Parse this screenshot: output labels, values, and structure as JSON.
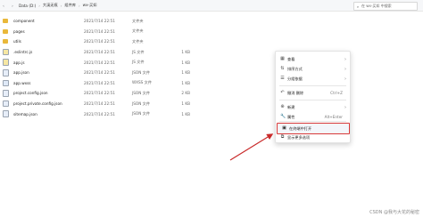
{
  "header": {
    "breadcrumb": [
      "Data (D:)",
      "大溪无痕",
      "组件库",
      "wx-买如"
    ],
    "search_placeholder": "在 wx-买如 中搜索"
  },
  "files": [
    {
      "name": "component",
      "date": "2021/7/14 22:51",
      "type": "文件夹",
      "size": "",
      "icon": "folder"
    },
    {
      "name": "pages",
      "date": "2021/7/14 22:51",
      "type": "文件夹",
      "size": "",
      "icon": "folder"
    },
    {
      "name": "utils",
      "date": "2021/7/14 22:51",
      "type": "文件夹",
      "size": "",
      "icon": "folder"
    },
    {
      "name": ".eslintrc.js",
      "date": "2021/7/14 22:51",
      "type": "JS 文件",
      "size": "1 KB",
      "icon": "js"
    },
    {
      "name": "app.js",
      "date": "2021/7/14 22:51",
      "type": "JS 文件",
      "size": "1 KB",
      "icon": "js"
    },
    {
      "name": "app.json",
      "date": "2021/7/14 22:51",
      "type": "JSON 文件",
      "size": "1 KB",
      "icon": "json"
    },
    {
      "name": "app.wxss",
      "date": "2021/7/14 22:51",
      "type": "WXSS 文件",
      "size": "1 KB",
      "icon": "wxss"
    },
    {
      "name": "project.config.json",
      "date": "2021/7/14 22:51",
      "type": "JSON 文件",
      "size": "2 KB",
      "icon": "json"
    },
    {
      "name": "project.private.config.json",
      "date": "2021/7/14 22:51",
      "type": "JSON 文件",
      "size": "1 KB",
      "icon": "json"
    },
    {
      "name": "sitemap.json",
      "date": "2021/7/14 22:51",
      "type": "JSON 文件",
      "size": "1 KB",
      "icon": "json"
    }
  ],
  "context_menu": [
    {
      "label": "查看",
      "shortcut": "",
      "submenu": true,
      "icon": "view-icon"
    },
    {
      "label": "排序方式",
      "shortcut": "",
      "submenu": true,
      "icon": "sort-icon"
    },
    {
      "label": "分组依据",
      "shortcut": "",
      "submenu": true,
      "icon": "group-icon"
    },
    {
      "label": "撤消 删除",
      "shortcut": "Ctrl+Z",
      "submenu": false,
      "icon": "undo-icon"
    },
    {
      "label": "新建",
      "shortcut": "",
      "submenu": true,
      "icon": "new-icon"
    },
    {
      "label": "属性",
      "shortcut": "Alt+Enter",
      "submenu": false,
      "icon": "properties-icon"
    },
    {
      "label": "在终端中打开",
      "shortcut": "",
      "submenu": false,
      "icon": "terminal-icon",
      "highlighted": true
    },
    {
      "label": "显示更多选项",
      "shortcut": "",
      "submenu": false,
      "icon": "more-options-icon"
    }
  ],
  "watermark": "CSDN @我与大花的秘密",
  "colors": {
    "highlight_border": "#d83a3a",
    "arrow": "#c92a2a"
  }
}
